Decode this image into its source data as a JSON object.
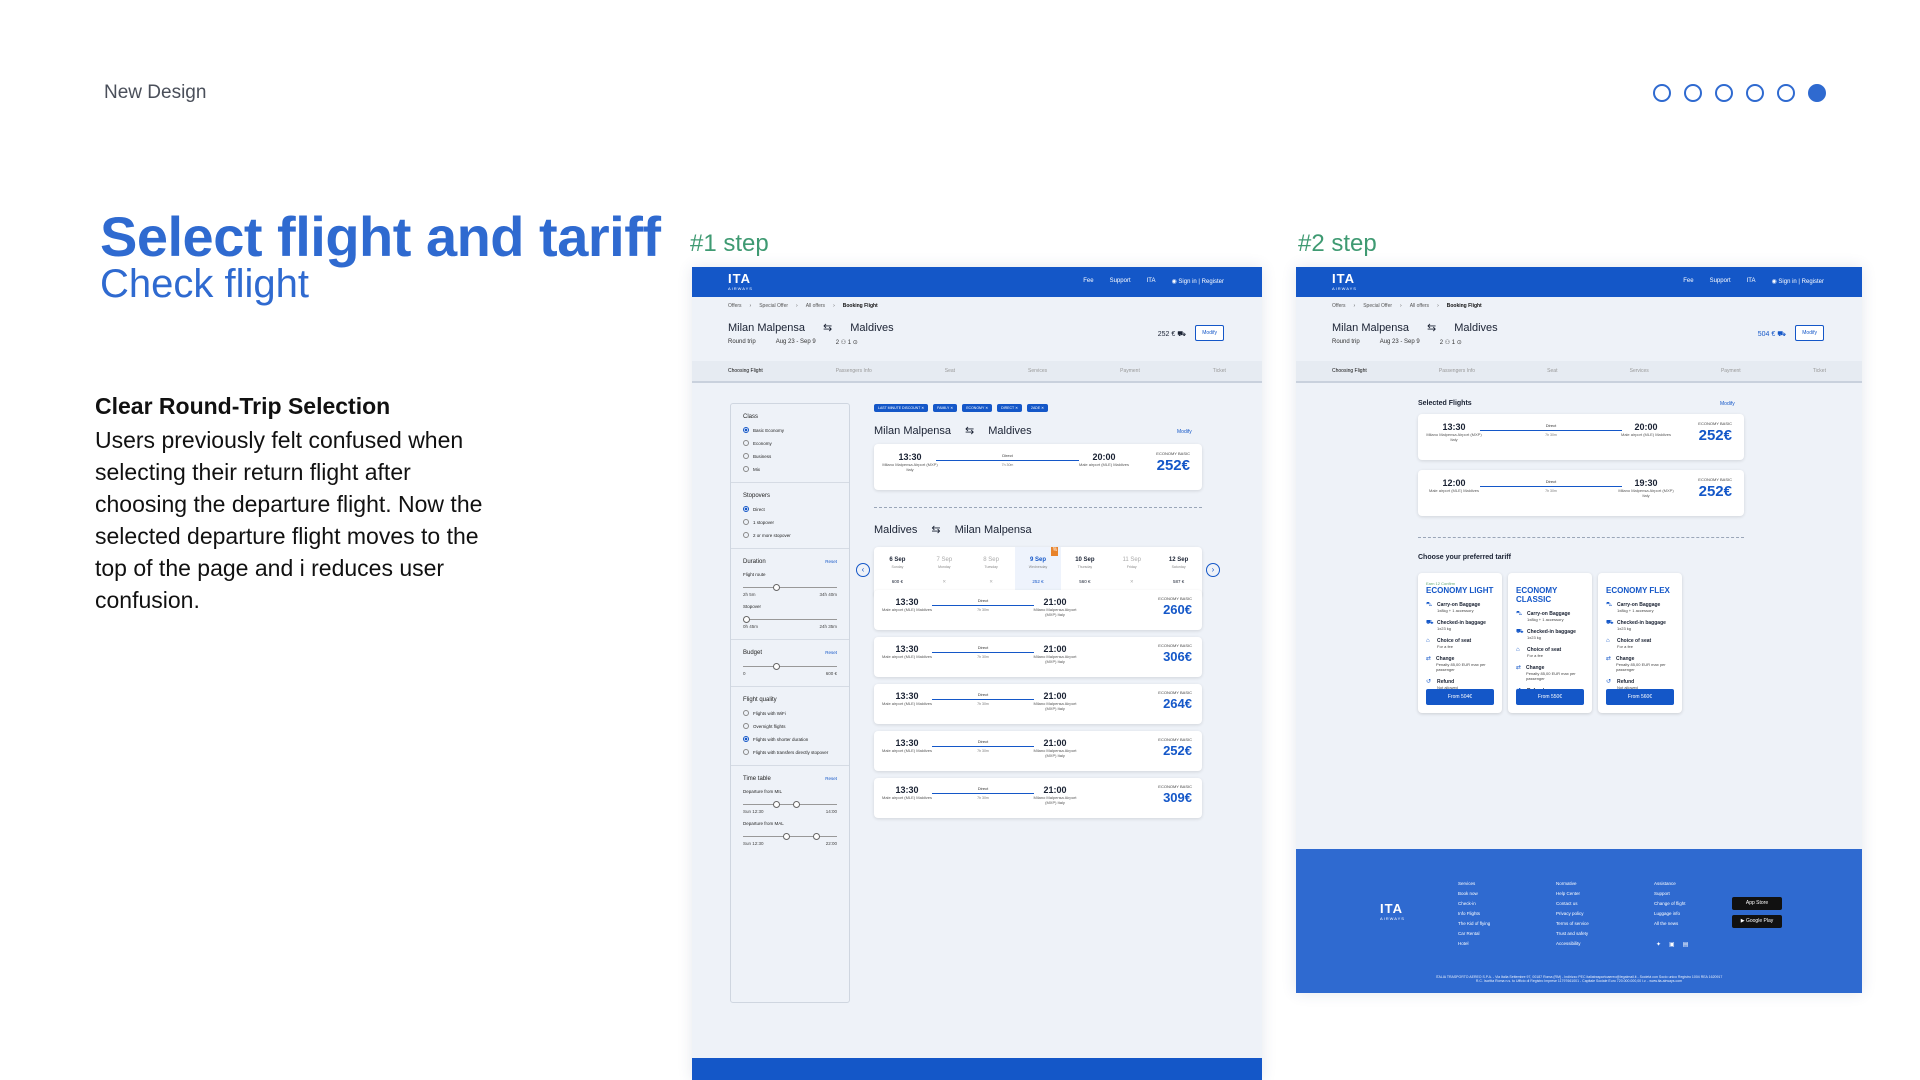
{
  "slide": {
    "label": "New Design",
    "title": "Select flight and tariff",
    "subtitle": "Check flight",
    "feature_title": "Clear Round-Trip Selection",
    "feature_body": "Users previously felt confused when selecting their return flight after choosing the departure flight. Now the selected departure flight moves to the top of the page and i reduces user confusion.",
    "pager_total": 6,
    "pager_active": 6
  },
  "common": {
    "logo": "ITA",
    "logo_sub": "AIRWAYS",
    "nav": [
      "Fee",
      "Support",
      "ITA",
      "Sign in | Register"
    ],
    "crumbs": [
      "Offers",
      "Special Offer",
      "All offers",
      "Booking Flight"
    ],
    "origin": "Milan Malpensa",
    "dest": "Maldives",
    "trip_type": "Round trip",
    "dates": "Aug 23 - Sep 9",
    "pax": "2",
    "bags": "1",
    "modify": "Modify",
    "steps": [
      "Choosing Flight",
      "Passengers Info",
      "Seat",
      "Services",
      "Payment",
      "Ticket"
    ]
  },
  "step1": {
    "label": "#1 step",
    "header_price": "252 €",
    "filters": {
      "class_title": "Class",
      "class_opts": [
        "Basic Economy",
        "Economy",
        "Business",
        "Mix"
      ],
      "stop_title": "Stopovers",
      "stop_opts": [
        "Direct",
        "1 stopover",
        "2 or more stopover"
      ],
      "duration_title": "Duration",
      "reset": "Reset",
      "route_label": "Flight route",
      "route_range": [
        "2h 5m",
        "34h 40m"
      ],
      "stopover_label": "Stopover",
      "stopover_range": [
        "0h 45m",
        "24h 35m"
      ],
      "budget_title": "Budget",
      "budget_range": [
        "0",
        "600 €"
      ],
      "quality_title": "Flight quality",
      "quality_opts": [
        "Flights with WiFi",
        "Overnight flights",
        "Flights with shorter duration",
        "Flights with transfers directly stopover"
      ],
      "timetable_title": "Time table",
      "dep_mil": "Departure from MIL",
      "dep_mil_range": [
        "Sun 12:30",
        "14:00"
      ],
      "dep_mal": "Departure from MAL",
      "dep_mal_range": [
        "Sun 12:30",
        "22:00"
      ]
    },
    "chips": [
      "LAST MINUTE DISCOUNT",
      "FAMILY",
      "ECONOMY",
      "DIRECT",
      "2ADE"
    ],
    "outbound": {
      "from": "Milan Malpensa",
      "to": "Maldives",
      "modify": "Modify",
      "dep": "13:30",
      "dep_place": "Milano Malpensa Airport (MXP) Italy",
      "arr": "20:00",
      "arr_place": "Male airport (MLE) Maldives",
      "type": "Direct",
      "dur": "7h 30m",
      "cls": "ECONOMY BASIC",
      "price": "252€"
    },
    "return_title": {
      "from": "Maldives",
      "to": "Milan Malpensa"
    },
    "dates": [
      {
        "d": "6 Sep",
        "w": "Sunday",
        "p": "600 €",
        "state": "normal"
      },
      {
        "d": "7 Sep",
        "w": "Monday",
        "p": "✕",
        "state": "dim"
      },
      {
        "d": "8 Sep",
        "w": "Tuesday",
        "p": "✕",
        "state": "dim"
      },
      {
        "d": "9 Sep",
        "w": "Wednesday",
        "p": "252 €",
        "state": "sel"
      },
      {
        "d": "10 Sep",
        "w": "Thursday",
        "p": "560 €",
        "state": "normal"
      },
      {
        "d": "11 Sep",
        "w": "Friday",
        "p": "✕",
        "state": "dim"
      },
      {
        "d": "12 Sep",
        "w": "Saturday",
        "p": "587 €",
        "state": "normal"
      }
    ],
    "return_flights": [
      {
        "dep": "13:30",
        "arr": "21:00",
        "price": "260€"
      },
      {
        "dep": "13:30",
        "arr": "21:00",
        "price": "306€"
      },
      {
        "dep": "13:30",
        "arr": "21:00",
        "price": "264€"
      },
      {
        "dep": "13:30",
        "arr": "21:00",
        "price": "252€"
      },
      {
        "dep": "13:30",
        "arr": "21:00",
        "price": "309€"
      }
    ],
    "return_dep_place": "Male airport (MLE) Maldives",
    "return_arr_place": "Milano Malpensa Airport (MXP) Italy",
    "return_type": "Direct",
    "return_dur": "7h 30m",
    "return_cls": "ECONOMY BASIC"
  },
  "step2": {
    "label": "#2 step",
    "header_price": "504 €",
    "selected_title": "Selected Flights",
    "modify": "Modify",
    "flights": [
      {
        "dep": "13:30",
        "dep_place": "Milano Malpensa Airport (MXP) Italy",
        "arr": "20:00",
        "arr_place": "Male airport (MLE) Maldives",
        "type": "Direct",
        "dur": "7h 30m",
        "cls": "ECONOMY BASIC",
        "price": "252€"
      },
      {
        "dep": "12:00",
        "dep_place": "Male airport (MLE) Maldives",
        "arr": "19:30",
        "arr_place": "Milano Malpensa Airport (MXP) Italy",
        "type": "Direct",
        "dur": "7h 30m",
        "cls": "ECONOMY BASIC",
        "price": "252€"
      }
    ],
    "tariff_title": "Choose your preferred tariff",
    "tariffs": [
      {
        "caption": "Earn 12 Confirm",
        "name": "ECONOMY LIGHT",
        "btn": "From 504€"
      },
      {
        "caption": "",
        "name": "ECONOMY CLASSIC",
        "btn": "From 550€"
      },
      {
        "caption": "",
        "name": "ECONOMY FLEX",
        "btn": "From 560€"
      }
    ],
    "tariff_rows": [
      {
        "t": "Carry-on Baggage",
        "s": "1x8kg + 1 accessory"
      },
      {
        "t": "Checked-in baggage",
        "s": "1x23 kg"
      },
      {
        "t": "Choice of seat",
        "s": "For a fee"
      },
      {
        "t": "Change",
        "s": "Penalty 85,00 EUR max per passenger"
      },
      {
        "t": "Refund",
        "s": "Not allowed"
      }
    ],
    "footer": {
      "col1": [
        "Services",
        "Book now",
        "Check-in",
        "Info Flights",
        "The Kid of flying",
        "Car Rental",
        "Hotel"
      ],
      "col2": [
        "Normative",
        "Help Center",
        "Contact us",
        "Privacy policy",
        "Terms of service",
        "Trust and safety",
        "Accessibility"
      ],
      "col3": [
        "Assistance",
        "Support",
        "Change of flight",
        "Luggage info",
        "All the news"
      ],
      "app_store": "App Store",
      "google_play": "Google Play",
      "social": [
        "twitter-icon",
        "instagram-icon",
        "facebook-icon"
      ],
      "legal1": "ITALIA TRASPORTO AEREO S.P.A. - Via Italia Settembre 97, 00187 Roma (RM) - Indirizzo PEC italiatrasportoaereo@legalmail.it - Società con Socio unico Registro 1004 REA 1620917",
      "legal2": "R.C. Iscritta Roma n.s. to Ufficio di Registro Imprese 11797661001 - Capitale Sociale Euro 720.000.000,00 i.v. - www.ita-airways.com"
    }
  }
}
